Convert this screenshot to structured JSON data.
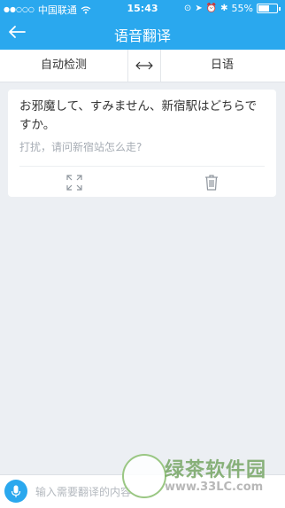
{
  "status_bar": {
    "carrier": "中国联通",
    "time": "15:43",
    "battery": "55%"
  },
  "header": {
    "title": "语音翻译"
  },
  "language_bar": {
    "source": "自动检测",
    "target": "日语"
  },
  "translation_card": {
    "source_text": "お邪魔して、すみません、新宿駅はどちらですか。",
    "translated_text": "打扰，请问新宿站怎么走?"
  },
  "input_bar": {
    "placeholder": "输入需要翻译的内容"
  },
  "watermark": {
    "title": "绿茶软件园",
    "url": "www.33LC.com"
  },
  "colors": {
    "accent": "#2aa8ee",
    "background": "#eceff3"
  },
  "icons": [
    "wifi-icon",
    "back-arrow-icon",
    "swap-arrows-icon",
    "expand-icon",
    "trash-icon",
    "microphone-icon"
  ]
}
